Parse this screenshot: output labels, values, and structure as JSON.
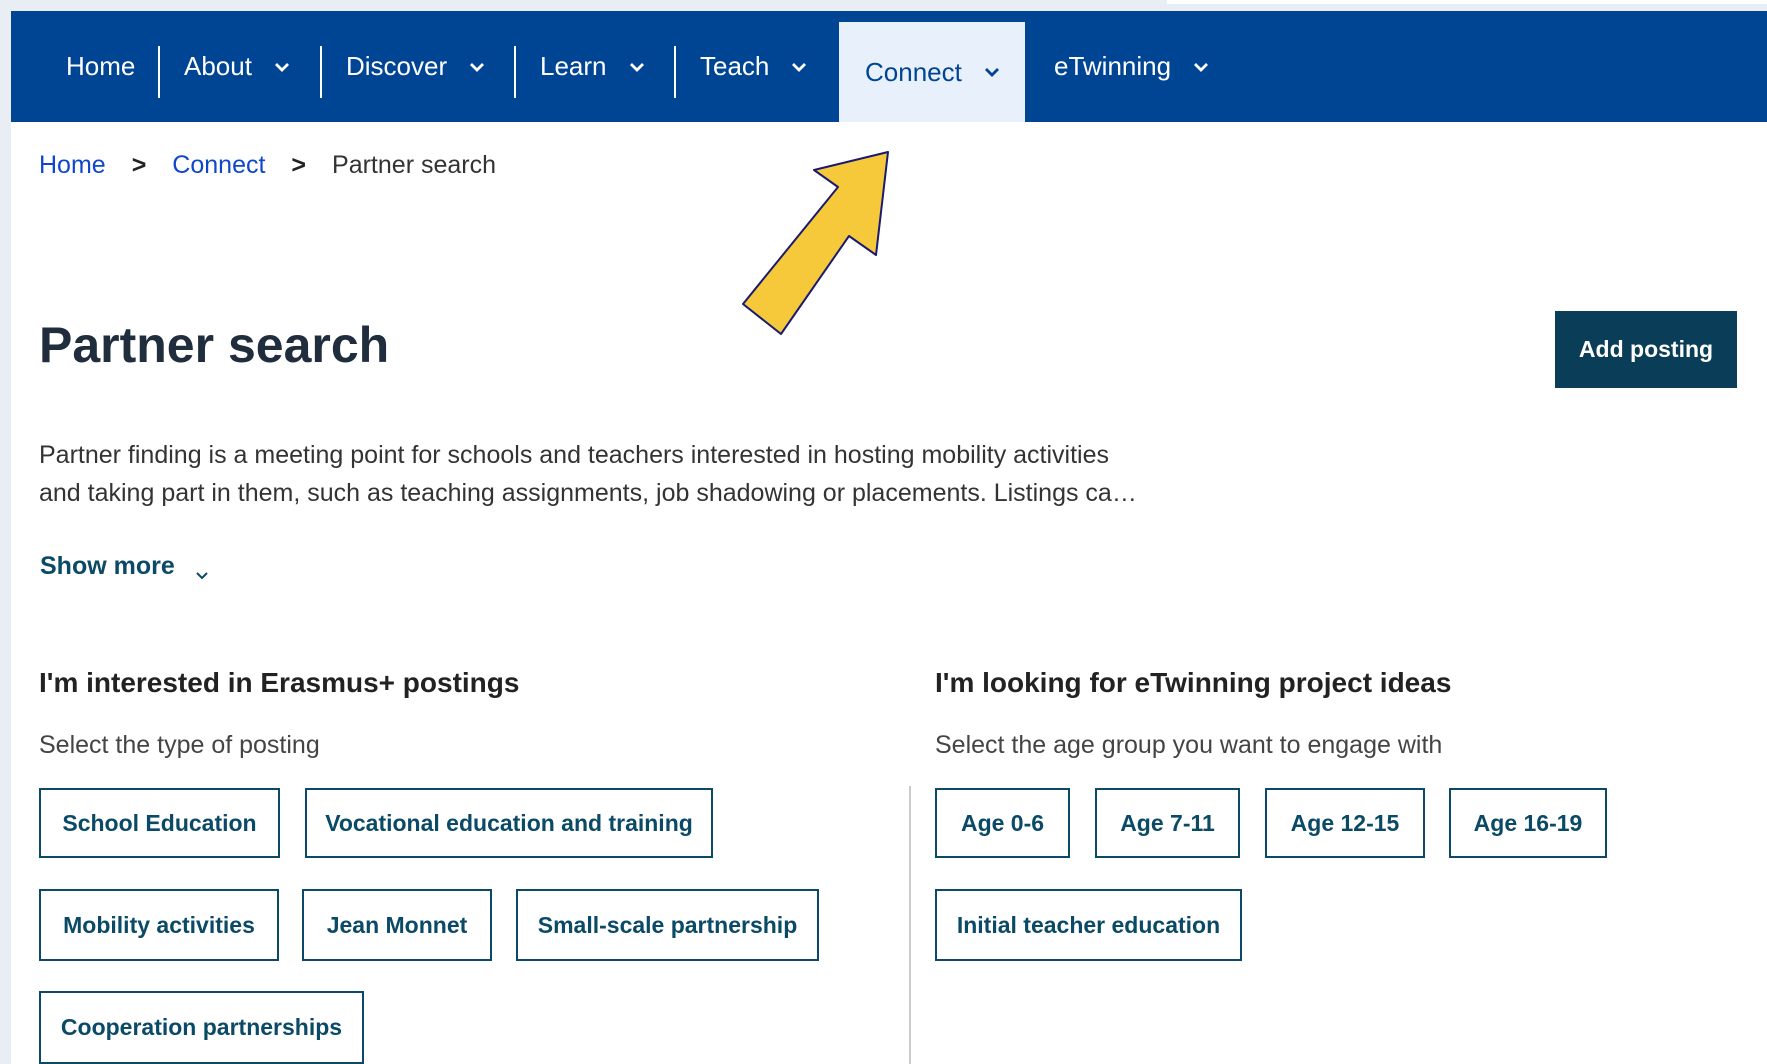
{
  "nav": {
    "items": [
      {
        "label": "Home",
        "has_dropdown": false
      },
      {
        "label": "About",
        "has_dropdown": true
      },
      {
        "label": "Discover",
        "has_dropdown": true
      },
      {
        "label": "Learn",
        "has_dropdown": true
      },
      {
        "label": "Teach",
        "has_dropdown": true
      },
      {
        "label": "Connect",
        "has_dropdown": true,
        "active": true
      },
      {
        "label": "eTwinning",
        "has_dropdown": true
      }
    ]
  },
  "breadcrumb": {
    "items": [
      "Home",
      "Connect",
      "Partner search"
    ]
  },
  "page": {
    "title": "Partner search",
    "add_button": "Add posting",
    "intro_line1": "Partner finding is a meeting point for schools and teachers interested in hosting mobility activities",
    "intro_line2": "and taking part in them, such as teaching assignments, job shadowing or placements. Listings ca…",
    "show_more": "Show more"
  },
  "erasmus": {
    "title": "I'm interested in Erasmus+ postings",
    "subtitle": "Select the type of posting",
    "options": [
      "School Education",
      "Vocational education and training",
      "Mobility activities",
      "Jean Monnet",
      "Small-scale partnership",
      "Cooperation partnerships"
    ]
  },
  "etwinning": {
    "title": "I'm looking for eTwinning project ideas",
    "subtitle": "Select the age group you want to engage with",
    "options": [
      "Age 0-6",
      "Age 7-11",
      "Age 12-15",
      "Age 16-19",
      "Initial teacher education"
    ]
  },
  "colors": {
    "nav_bg": "#004494",
    "active_tab_bg": "#e8f1fb",
    "button_dark": "#0a3d57",
    "chip_border": "#0b4a66",
    "annotation_arrow": "#f5c93a"
  },
  "icons": {
    "dropdown": "chevron-down-icon",
    "breadcrumb_separator": "chevron-right-icon",
    "annotation": "arrow-pointer-icon"
  }
}
